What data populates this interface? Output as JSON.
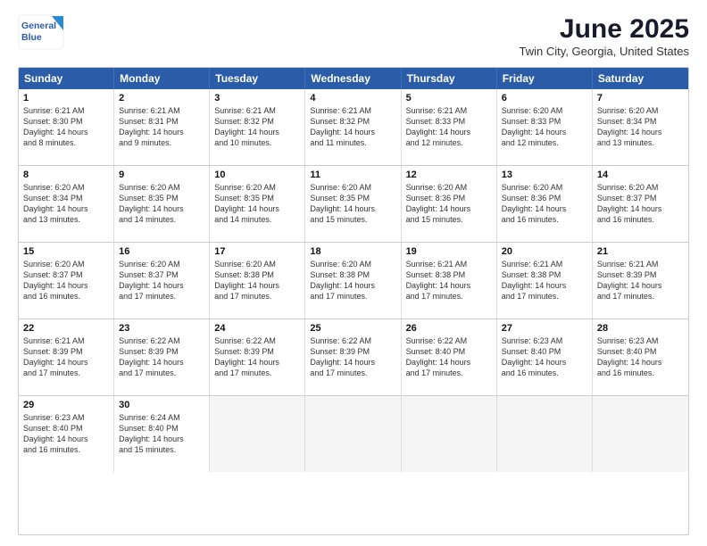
{
  "header": {
    "logo_line1": "General",
    "logo_line2": "Blue",
    "title": "June 2025",
    "subtitle": "Twin City, Georgia, United States"
  },
  "calendar": {
    "days_of_week": [
      "Sunday",
      "Monday",
      "Tuesday",
      "Wednesday",
      "Thursday",
      "Friday",
      "Saturday"
    ],
    "rows": [
      [
        {
          "day": "1",
          "lines": [
            "Sunrise: 6:21 AM",
            "Sunset: 8:30 PM",
            "Daylight: 14 hours",
            "and 8 minutes."
          ]
        },
        {
          "day": "2",
          "lines": [
            "Sunrise: 6:21 AM",
            "Sunset: 8:31 PM",
            "Daylight: 14 hours",
            "and 9 minutes."
          ]
        },
        {
          "day": "3",
          "lines": [
            "Sunrise: 6:21 AM",
            "Sunset: 8:32 PM",
            "Daylight: 14 hours",
            "and 10 minutes."
          ]
        },
        {
          "day": "4",
          "lines": [
            "Sunrise: 6:21 AM",
            "Sunset: 8:32 PM",
            "Daylight: 14 hours",
            "and 11 minutes."
          ]
        },
        {
          "day": "5",
          "lines": [
            "Sunrise: 6:21 AM",
            "Sunset: 8:33 PM",
            "Daylight: 14 hours",
            "and 12 minutes."
          ]
        },
        {
          "day": "6",
          "lines": [
            "Sunrise: 6:20 AM",
            "Sunset: 8:33 PM",
            "Daylight: 14 hours",
            "and 12 minutes."
          ]
        },
        {
          "day": "7",
          "lines": [
            "Sunrise: 6:20 AM",
            "Sunset: 8:34 PM",
            "Daylight: 14 hours",
            "and 13 minutes."
          ]
        }
      ],
      [
        {
          "day": "8",
          "lines": [
            "Sunrise: 6:20 AM",
            "Sunset: 8:34 PM",
            "Daylight: 14 hours",
            "and 13 minutes."
          ]
        },
        {
          "day": "9",
          "lines": [
            "Sunrise: 6:20 AM",
            "Sunset: 8:35 PM",
            "Daylight: 14 hours",
            "and 14 minutes."
          ]
        },
        {
          "day": "10",
          "lines": [
            "Sunrise: 6:20 AM",
            "Sunset: 8:35 PM",
            "Daylight: 14 hours",
            "and 14 minutes."
          ]
        },
        {
          "day": "11",
          "lines": [
            "Sunrise: 6:20 AM",
            "Sunset: 8:35 PM",
            "Daylight: 14 hours",
            "and 15 minutes."
          ]
        },
        {
          "day": "12",
          "lines": [
            "Sunrise: 6:20 AM",
            "Sunset: 8:36 PM",
            "Daylight: 14 hours",
            "and 15 minutes."
          ]
        },
        {
          "day": "13",
          "lines": [
            "Sunrise: 6:20 AM",
            "Sunset: 8:36 PM",
            "Daylight: 14 hours",
            "and 16 minutes."
          ]
        },
        {
          "day": "14",
          "lines": [
            "Sunrise: 6:20 AM",
            "Sunset: 8:37 PM",
            "Daylight: 14 hours",
            "and 16 minutes."
          ]
        }
      ],
      [
        {
          "day": "15",
          "lines": [
            "Sunrise: 6:20 AM",
            "Sunset: 8:37 PM",
            "Daylight: 14 hours",
            "and 16 minutes."
          ]
        },
        {
          "day": "16",
          "lines": [
            "Sunrise: 6:20 AM",
            "Sunset: 8:37 PM",
            "Daylight: 14 hours",
            "and 17 minutes."
          ]
        },
        {
          "day": "17",
          "lines": [
            "Sunrise: 6:20 AM",
            "Sunset: 8:38 PM",
            "Daylight: 14 hours",
            "and 17 minutes."
          ]
        },
        {
          "day": "18",
          "lines": [
            "Sunrise: 6:20 AM",
            "Sunset: 8:38 PM",
            "Daylight: 14 hours",
            "and 17 minutes."
          ]
        },
        {
          "day": "19",
          "lines": [
            "Sunrise: 6:21 AM",
            "Sunset: 8:38 PM",
            "Daylight: 14 hours",
            "and 17 minutes."
          ]
        },
        {
          "day": "20",
          "lines": [
            "Sunrise: 6:21 AM",
            "Sunset: 8:38 PM",
            "Daylight: 14 hours",
            "and 17 minutes."
          ]
        },
        {
          "day": "21",
          "lines": [
            "Sunrise: 6:21 AM",
            "Sunset: 8:39 PM",
            "Daylight: 14 hours",
            "and 17 minutes."
          ]
        }
      ],
      [
        {
          "day": "22",
          "lines": [
            "Sunrise: 6:21 AM",
            "Sunset: 8:39 PM",
            "Daylight: 14 hours",
            "and 17 minutes."
          ]
        },
        {
          "day": "23",
          "lines": [
            "Sunrise: 6:22 AM",
            "Sunset: 8:39 PM",
            "Daylight: 14 hours",
            "and 17 minutes."
          ]
        },
        {
          "day": "24",
          "lines": [
            "Sunrise: 6:22 AM",
            "Sunset: 8:39 PM",
            "Daylight: 14 hours",
            "and 17 minutes."
          ]
        },
        {
          "day": "25",
          "lines": [
            "Sunrise: 6:22 AM",
            "Sunset: 8:39 PM",
            "Daylight: 14 hours",
            "and 17 minutes."
          ]
        },
        {
          "day": "26",
          "lines": [
            "Sunrise: 6:22 AM",
            "Sunset: 8:40 PM",
            "Daylight: 14 hours",
            "and 17 minutes."
          ]
        },
        {
          "day": "27",
          "lines": [
            "Sunrise: 6:23 AM",
            "Sunset: 8:40 PM",
            "Daylight: 14 hours",
            "and 16 minutes."
          ]
        },
        {
          "day": "28",
          "lines": [
            "Sunrise: 6:23 AM",
            "Sunset: 8:40 PM",
            "Daylight: 14 hours",
            "and 16 minutes."
          ]
        }
      ],
      [
        {
          "day": "29",
          "lines": [
            "Sunrise: 6:23 AM",
            "Sunset: 8:40 PM",
            "Daylight: 14 hours",
            "and 16 minutes."
          ]
        },
        {
          "day": "30",
          "lines": [
            "Sunrise: 6:24 AM",
            "Sunset: 8:40 PM",
            "Daylight: 14 hours",
            "and 15 minutes."
          ]
        },
        {
          "day": "",
          "lines": []
        },
        {
          "day": "",
          "lines": []
        },
        {
          "day": "",
          "lines": []
        },
        {
          "day": "",
          "lines": []
        },
        {
          "day": "",
          "lines": []
        }
      ]
    ]
  }
}
